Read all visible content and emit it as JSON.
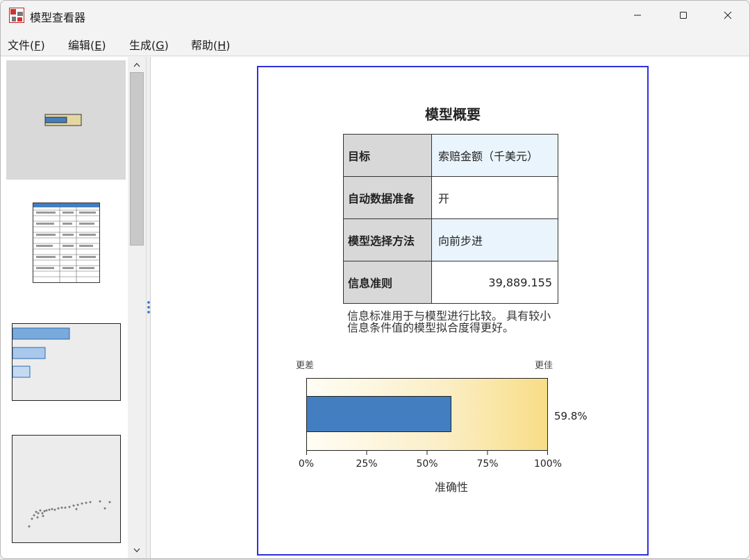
{
  "window": {
    "title": "模型查看器"
  },
  "menu": {
    "items": [
      {
        "text": "文件(",
        "key": "F",
        "close": ")"
      },
      {
        "text": "编辑(",
        "key": "E",
        "close": ")"
      },
      {
        "text": "生成(",
        "key": "G",
        "close": ")"
      },
      {
        "text": "帮助(",
        "key": "H",
        "close": ")"
      }
    ]
  },
  "summary": {
    "title": "模型概要",
    "rows": [
      {
        "key": "目标",
        "value": "索赔金额（千美元）"
      },
      {
        "key": "自动数据准备",
        "value": "开"
      },
      {
        "key": "模型选择方法",
        "value": "向前步进"
      },
      {
        "key": "信息准则",
        "value": "39,889.155"
      }
    ],
    "note": "信息标准用于与模型进行比较。 具有较小信息条件值的模型拟合度得更好。"
  },
  "accuracy": {
    "worse_label": "更差",
    "better_label": "更佳",
    "value_label": "59.8%",
    "axis_title": "准确性"
  },
  "chart_data": {
    "type": "bar",
    "categories": [
      ""
    ],
    "values": [
      0.598
    ],
    "xlabel": "准确性",
    "xlim": [
      0,
      1
    ],
    "tick_labels": [
      "0%",
      "25%",
      "50%",
      "75%",
      "100%"
    ],
    "annotations": [
      "更差",
      "更佳",
      "59.8%"
    ],
    "colors": {
      "bar": "#437ec0",
      "background_start": "#fffdf5",
      "background_end": "#f8dd86"
    }
  },
  "colors": {
    "frame_border": "#2e2ee0",
    "table_key_bg": "#d8d8d8",
    "table_value_shade": "#eaf4fc"
  }
}
